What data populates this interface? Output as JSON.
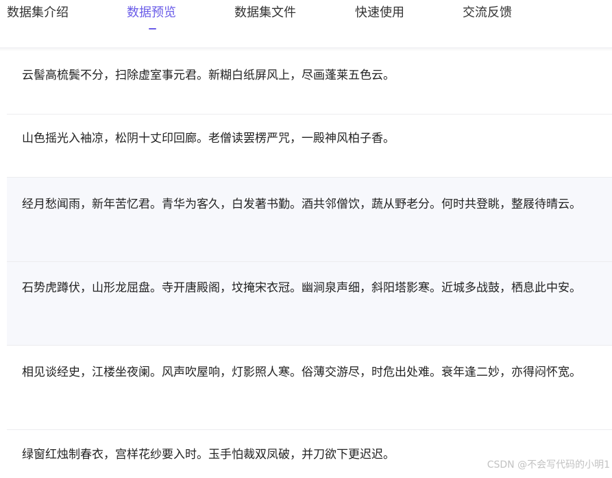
{
  "tabs": [
    {
      "label": "数据集介绍",
      "active": false
    },
    {
      "label": "数据预览",
      "active": true
    },
    {
      "label": "数据集文件",
      "active": false
    },
    {
      "label": "快速使用",
      "active": false
    },
    {
      "label": "交流反馈",
      "active": false
    }
  ],
  "colors": {
    "accent": "#6a5ce8",
    "row_alt_bg": "#f7f8fc"
  },
  "rows": [
    {
      "text": "云髻高梳鬓不分，扫除虚室事元君。新糊白纸屏风上，尽画蓬莱五色云。"
    },
    {
      "text": "山色摇光入袖凉，松阴十丈印回廊。老僧读罢楞严咒，一殿神风柏子香。"
    },
    {
      "text": "经月愁闻雨，新年苦忆君。青华为客久，白发著书勤。酒共邻僧饮，蔬从野老分。何时共登眺，整屐待晴云。"
    },
    {
      "text": "石势虎蹲伏，山形龙屈盘。寺开唐殿阁，坟掩宋衣冠。幽涧泉声细，斜阳塔影寒。近城多战鼓，栖息此中安。"
    },
    {
      "text": "相见谈经史，江楼坐夜阑。风声吹屋响，灯影照人寒。俗薄交游尽，时危出处难。衰年逢二妙，亦得闷怀宽。"
    },
    {
      "text": "绿窗红烛制春衣，宫样花纱要入时。玉手怕裁双凤破，并刀欲下更迟迟。"
    }
  ],
  "watermark": "CSDN @不会写代码的小明1"
}
